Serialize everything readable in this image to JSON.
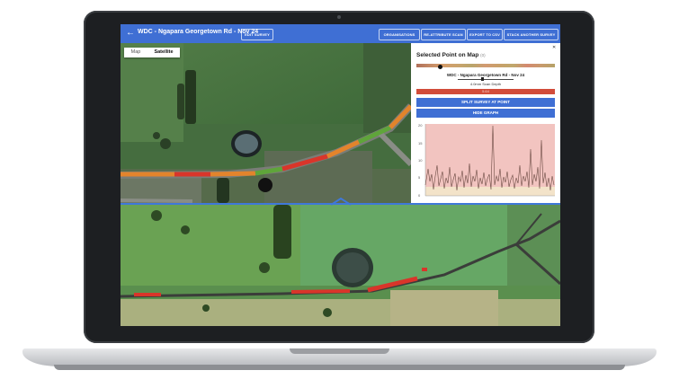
{
  "header": {
    "back_icon": "arrow-left-icon",
    "title": "WDC - Ngapara Georgetown Rd - Nov 24",
    "edit_survey": "EDIT SURVEY",
    "buttons": [
      "ORGANISATIONS",
      "RE-ATTRIBUTE SCAN",
      "EXPORT TO CSV",
      "STACK ANOTHER SURVEY"
    ]
  },
  "map": {
    "tabs": [
      {
        "label": "Map",
        "active": false
      },
      {
        "label": "Satellite",
        "active": true
      }
    ]
  },
  "panel": {
    "title": "Selected Point on Map",
    "title_sub": "(0)",
    "close_icon": "close-icon",
    "survey_name": "WDC - Ngapara Georgetown Rd - Nov 24",
    "scan_depth": "4.0mm Scan Depth",
    "value_label": "5.64",
    "split_button": "SPLIT SURVEY AT POINT",
    "hide_graph_button": "HIDE GRAPH",
    "graph": {
      "y_ticks": [
        "20",
        "15",
        "10",
        "5",
        "0"
      ],
      "threshold_colors": {
        "high": "#f2c4c0",
        "low": "#f3e3c9",
        "line": "#6b4a42"
      }
    }
  },
  "colors": {
    "header": "#3f6fd4",
    "divider": "#3f78d9",
    "road_red": "#d9352a",
    "road_orange": "#e3842c",
    "road_green": "#5fa53a"
  }
}
